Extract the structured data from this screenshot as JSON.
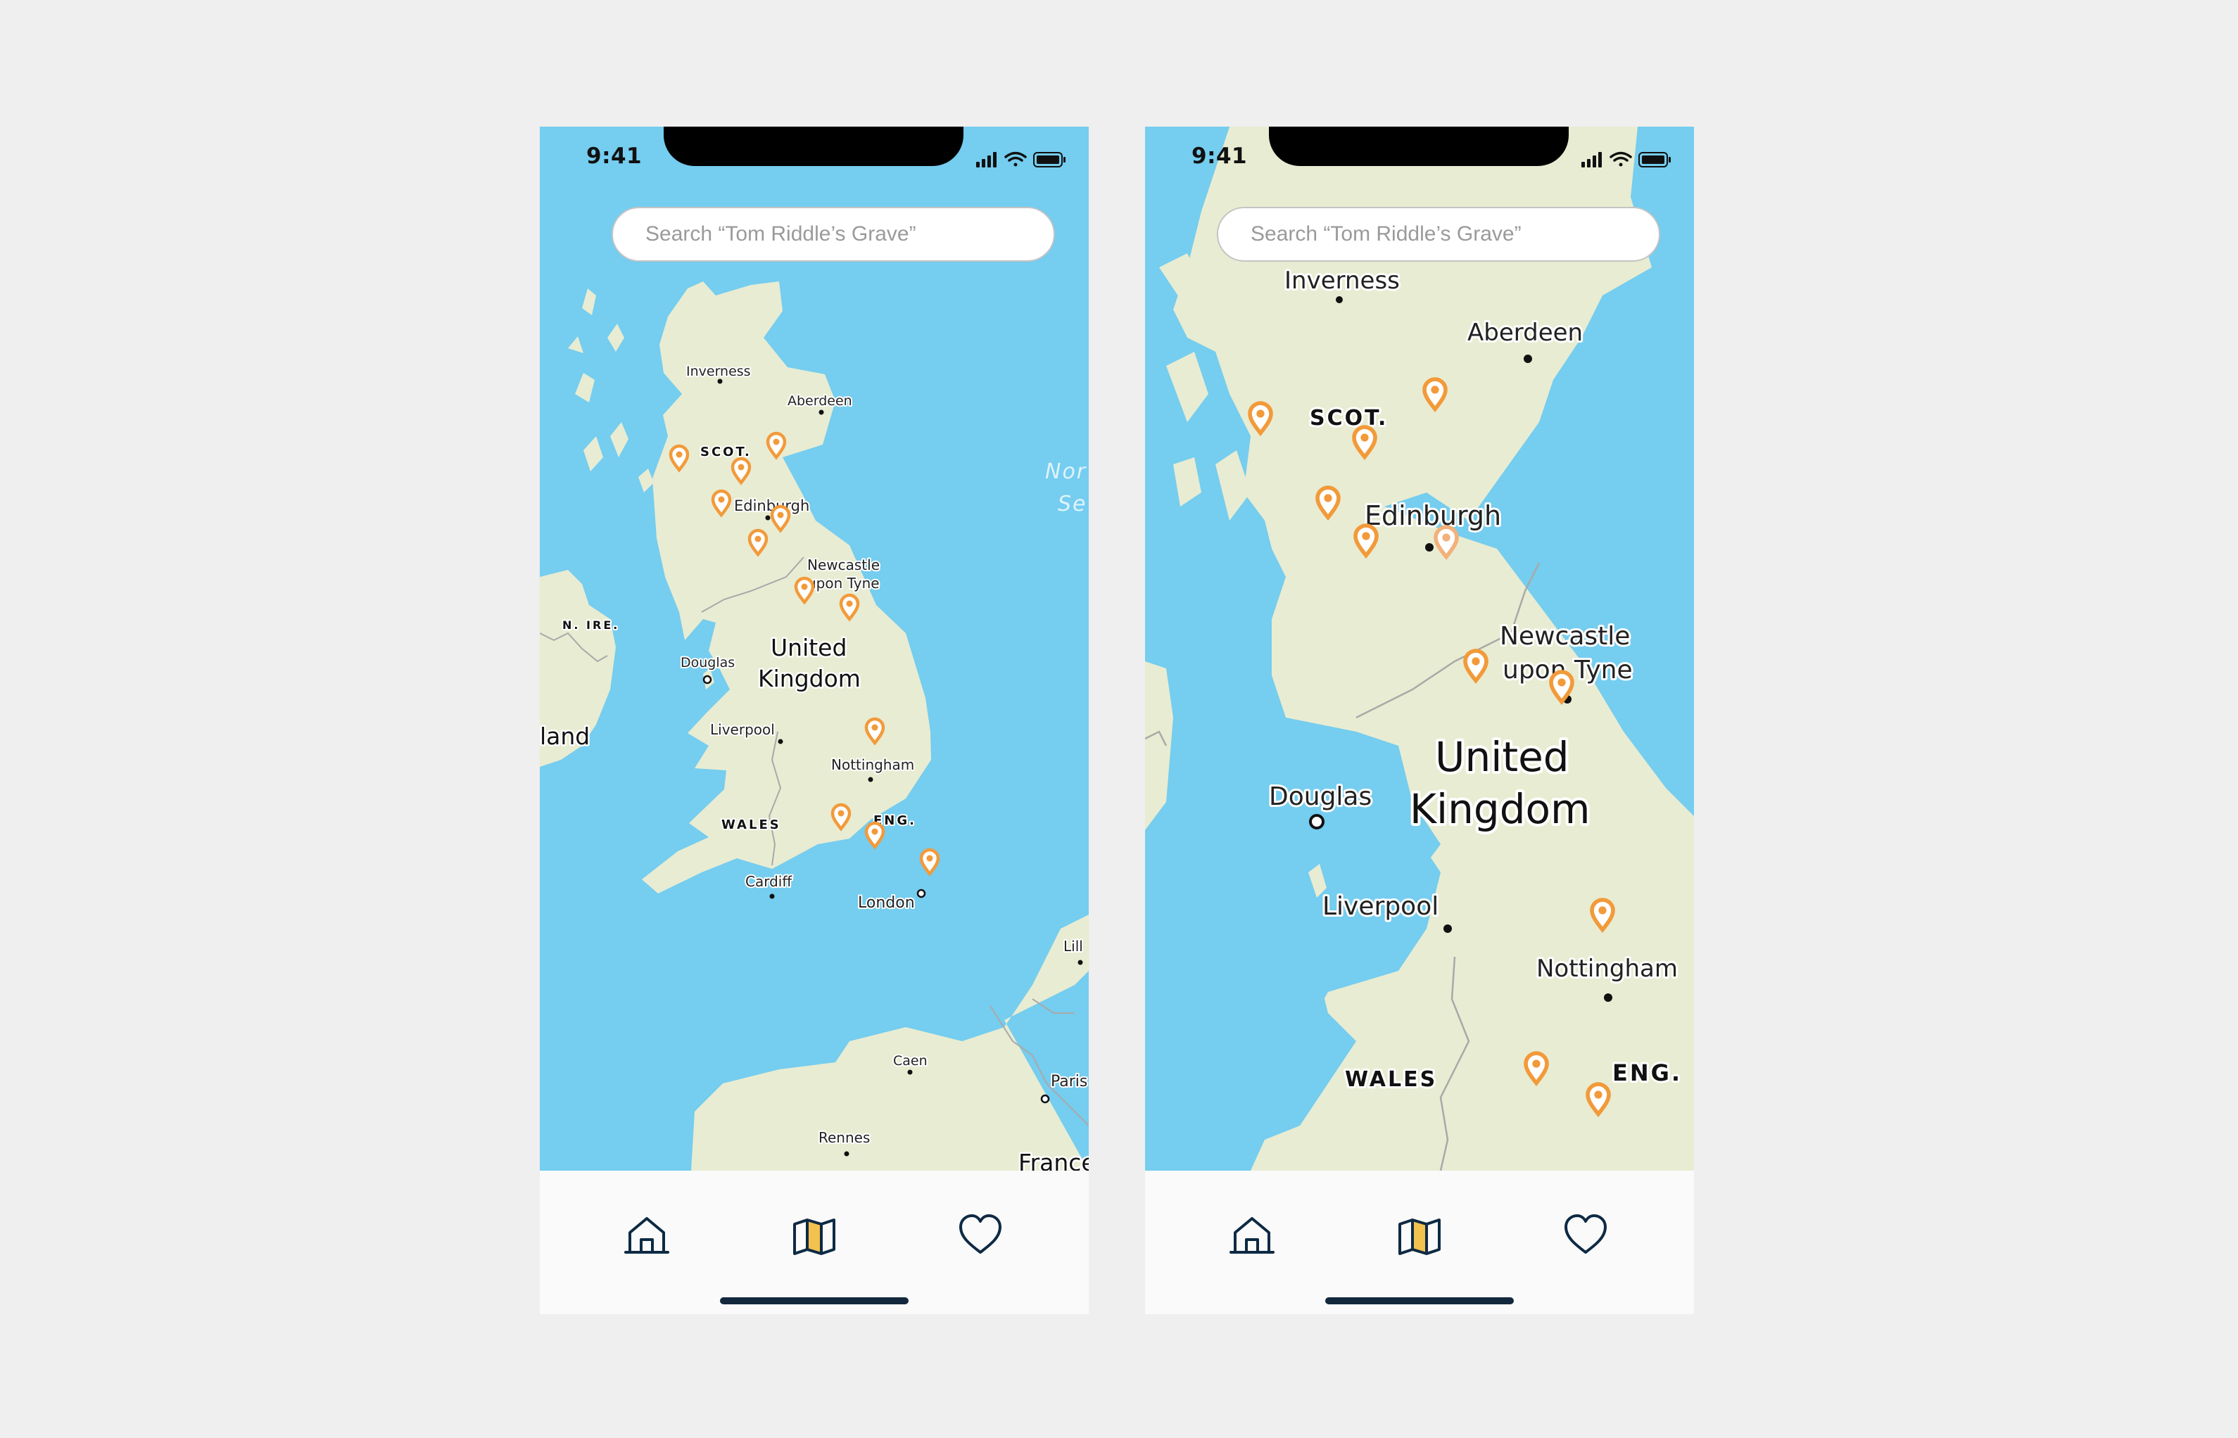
{
  "colors": {
    "background": "#efefef",
    "sea": "#75cdef",
    "land": "#e8ecd2",
    "pin": "#f29a3a",
    "pin_alt": "#f2b17a",
    "icon": "#0e2a44",
    "map_tab_fill": "#f2c14e"
  },
  "screens": [
    {
      "status": {
        "time": "9:41"
      },
      "search": {
        "placeholder": "Search “Tom Riddle’s Grave”"
      },
      "map": {
        "labels": {
          "inverness": "Inverness",
          "aberdeen": "Aberdeen",
          "scot": "SCOT.",
          "edinburgh": "Edinburgh",
          "newcastle_1": "Newcastle",
          "newcastle_2": "upon Tyne",
          "n_ire": "N. IRE.",
          "douglas": "Douglas",
          "uk_1": "United",
          "uk_2": "Kingdom",
          "ireland": "land",
          "liverpool": "Liverpool",
          "nottingham": "Nottingham",
          "wales": "WALES",
          "eng": "ENG.",
          "cardiff": "Cardiff",
          "london": "London",
          "lille": "Lill",
          "caen": "Caen",
          "paris": "Paris",
          "rennes": "Rennes",
          "france": "France",
          "north_sea_1": "Nor",
          "north_sea_2": "Se"
        },
        "pin_count": 12
      },
      "tabs": [
        {
          "icon": "home-icon"
        },
        {
          "icon": "map-icon"
        },
        {
          "icon": "heart-icon"
        }
      ]
    },
    {
      "status": {
        "time": "9:41"
      },
      "search": {
        "placeholder": "Search “Tom Riddle’s Grave”"
      },
      "map": {
        "labels": {
          "inverness": "Inverness",
          "aberdeen": "Aberdeen",
          "scot": "SCOT.",
          "edinburgh": "Edinburgh",
          "newcastle_1": "Newcastle",
          "newcastle_2": "upon Tyne",
          "uk_1": "United",
          "uk_2": "Kingdom",
          "douglas": "Douglas",
          "liverpool": "Liverpool",
          "nottingham": "Nottingham",
          "wales": "WALES",
          "eng": "ENG."
        },
        "pin_count": 11
      },
      "tabs": [
        {
          "icon": "home-icon"
        },
        {
          "icon": "map-icon"
        },
        {
          "icon": "heart-icon"
        }
      ]
    }
  ]
}
